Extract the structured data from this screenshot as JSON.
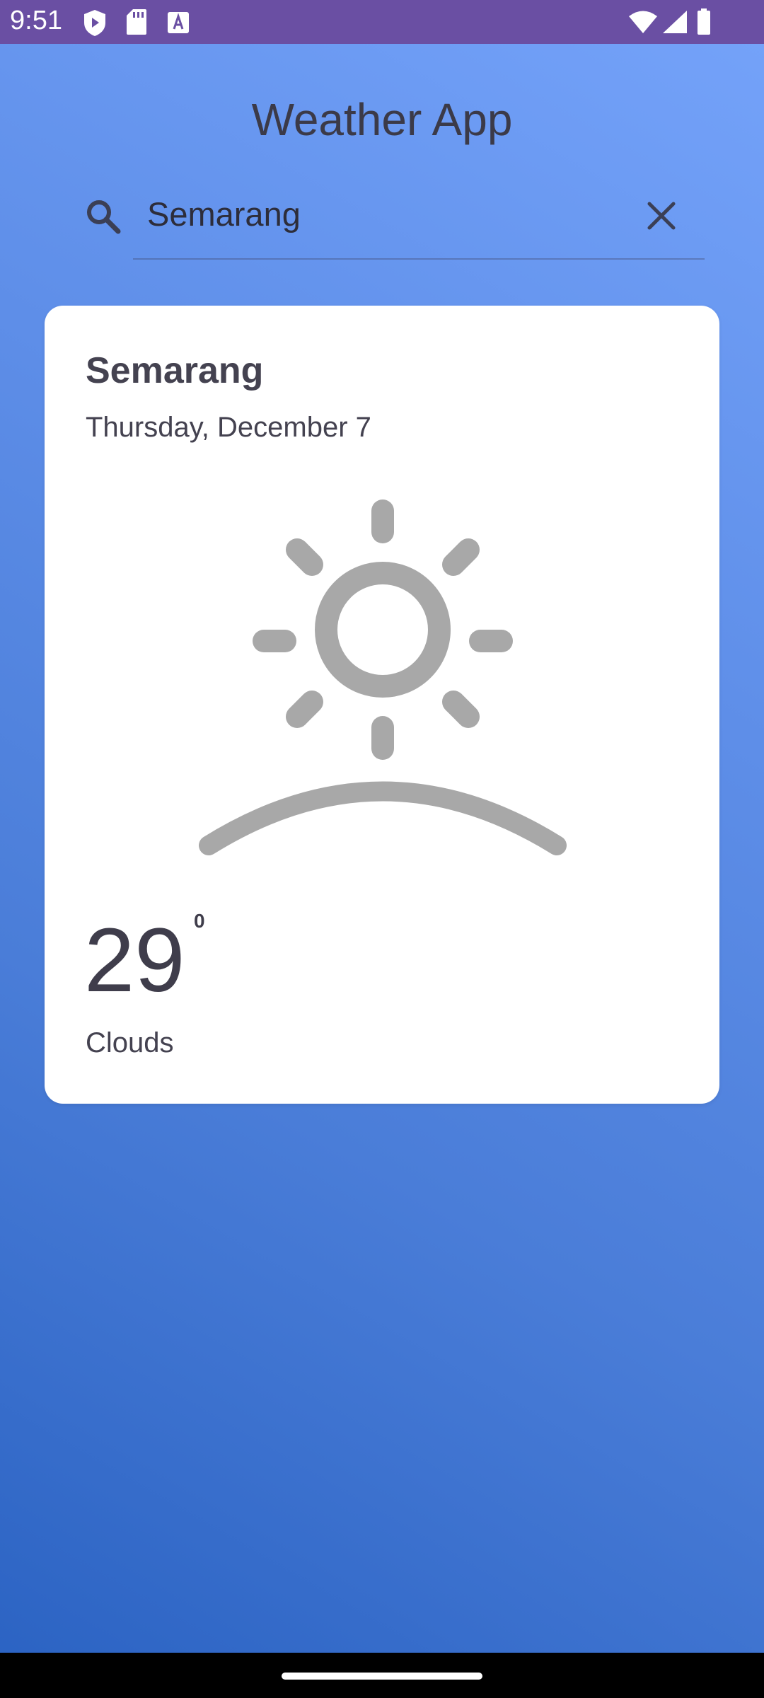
{
  "status_bar": {
    "time": "9:51",
    "icons": [
      "shield-icon",
      "sd-card-icon",
      "font-a-icon",
      "wifi-icon",
      "signal-icon",
      "battery-icon"
    ],
    "background_color": "#6a4fa3"
  },
  "header": {
    "title": "Weather App"
  },
  "search": {
    "value": "Semarang",
    "icons": [
      "search-icon",
      "close-icon"
    ]
  },
  "weather_card": {
    "city": "Semarang",
    "date": "Thursday, December 7",
    "icon": "sunrise-icon",
    "temperature": "29",
    "temperature_unit": "0",
    "condition": "Clouds"
  },
  "colors": {
    "background_top": "#75a3fa",
    "background_bottom": "#2a62c2",
    "card": "#ffffff",
    "icon_gray": "#a8a8a8",
    "text_dark": "#3f3d4b"
  }
}
